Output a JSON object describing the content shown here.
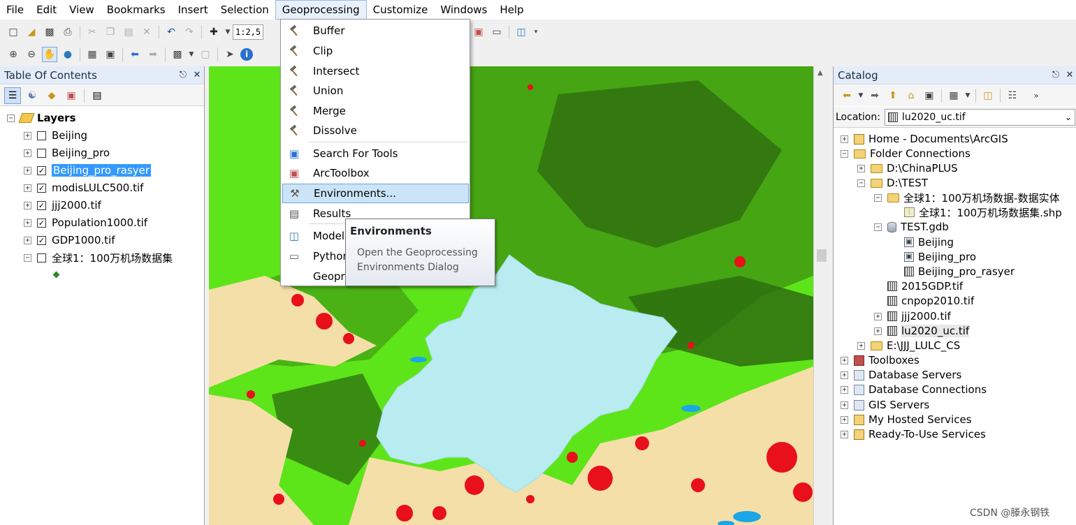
{
  "menubar": {
    "items": [
      "File",
      "Edit",
      "View",
      "Bookmarks",
      "Insert",
      "Selection",
      "Geoprocessing",
      "Customize",
      "Windows",
      "Help"
    ]
  },
  "toolbar": {
    "scale_text": "1:2,5"
  },
  "toc": {
    "title": "Table Of Contents",
    "root_label": "Layers",
    "layers": [
      {
        "name": "Beijing",
        "checked": false
      },
      {
        "name": "Beijing_pro",
        "checked": false
      },
      {
        "name": "Beijing_pro_rasyer",
        "checked": true
      },
      {
        "name": "modisLULC500.tif",
        "checked": true
      },
      {
        "name": "jjj2000.tif",
        "checked": true
      },
      {
        "name": "Population1000.tif",
        "checked": true
      },
      {
        "name": "GDP1000.tif",
        "checked": true
      },
      {
        "name": "全球1：100万机场数据集",
        "checked": false
      }
    ]
  },
  "geoprocessing_menu": {
    "items": [
      "Buffer",
      "Clip",
      "Intersect",
      "Union",
      "Merge",
      "Dissolve",
      "Search For Tools",
      "ArcToolbox",
      "Environments...",
      "Results",
      "Model",
      "Python",
      "Geopr"
    ]
  },
  "tooltip": {
    "title": "Environments",
    "line1": "Open the Geoprocessing",
    "line2": "Environments Dialog"
  },
  "catalog": {
    "title": "Catalog",
    "location_label": "Location:",
    "location_value": "lu2020_uc.tif",
    "tree": [
      "Home - Documents\\ArcGIS",
      "Folder Connections",
      "D:\\ChinaPLUS",
      "D:\\TEST",
      "全球1：100万机场数据-数据实体",
      "全球1：100万机场数据集.shp",
      "TEST.gdb",
      "Beijing",
      "Beijing_pro",
      "Beijing_pro_rasyer",
      "2015GDP.tif",
      "cnpop2010.tif",
      "jjj2000.tif",
      "lu2020_uc.tif",
      "E:\\JJJ_LULC_CS",
      "Toolboxes",
      "Database Servers",
      "Database Connections",
      "GIS Servers",
      "My Hosted Services",
      "Ready-To-Use Services"
    ]
  },
  "watermark": "CSDN @滕永钢铁",
  "colors": {
    "map_grass": "#5ee51a",
    "map_forest": "#2e6e10",
    "map_crop": "#f5dfa8",
    "map_builtup": "#e8101a",
    "map_area_fill": "#b8ecf0",
    "menu_highlight": "#cce4f7",
    "selection": "#3399ff"
  }
}
